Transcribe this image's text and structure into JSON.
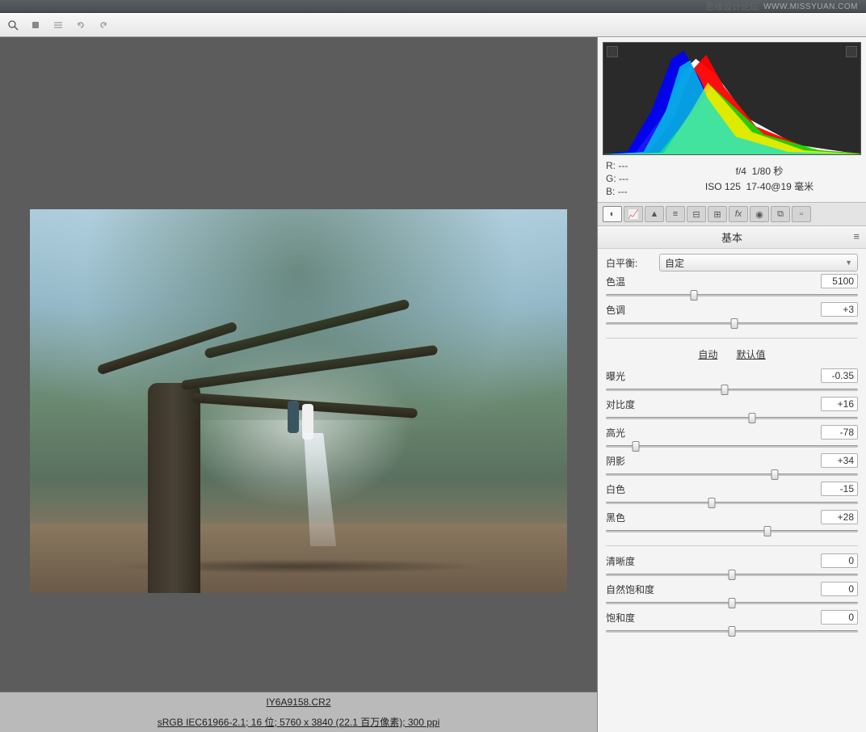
{
  "watermark": {
    "zh": "思缘设计论坛",
    "url": "WWW.MISSYUAN.COM"
  },
  "filename": "IY6A9158.CR2",
  "footer": "sRGB IEC61966-2.1; 16 位;  5760 x 3840 (22.1 百万像素); 300 ppi",
  "rgb": {
    "r_label": "R:",
    "g_label": "G:",
    "b_label": "B:",
    "dash": "---"
  },
  "exif": {
    "line1_a": "f/4",
    "line1_b": "1/80 秒",
    "line2_a": "ISO 125",
    "line2_b": "17-40@19 毫米"
  },
  "section_title": "基本",
  "white_balance": {
    "label": "白平衡:",
    "value": "自定"
  },
  "sliders": {
    "temperature": {
      "label": "色温",
      "value": "5100",
      "pos": 35
    },
    "tint": {
      "label": "色调",
      "value": "+3",
      "pos": 51
    },
    "exposure": {
      "label": "曝光",
      "value": "-0.35",
      "pos": 47
    },
    "contrast": {
      "label": "对比度",
      "value": "+16",
      "pos": 58
    },
    "highlights": {
      "label": "高光",
      "value": "-78",
      "pos": 12
    },
    "shadows": {
      "label": "阴影",
      "value": "+34",
      "pos": 67
    },
    "whites": {
      "label": "白色",
      "value": "-15",
      "pos": 42
    },
    "blacks": {
      "label": "黑色",
      "value": "+28",
      "pos": 64
    },
    "clarity": {
      "label": "清晰度",
      "value": "0",
      "pos": 50
    },
    "vibrance": {
      "label": "自然饱和度",
      "value": "0",
      "pos": 50
    },
    "saturation": {
      "label": "饱和度",
      "value": "0",
      "pos": 50
    }
  },
  "links": {
    "auto": "自动",
    "default": "默认值"
  }
}
